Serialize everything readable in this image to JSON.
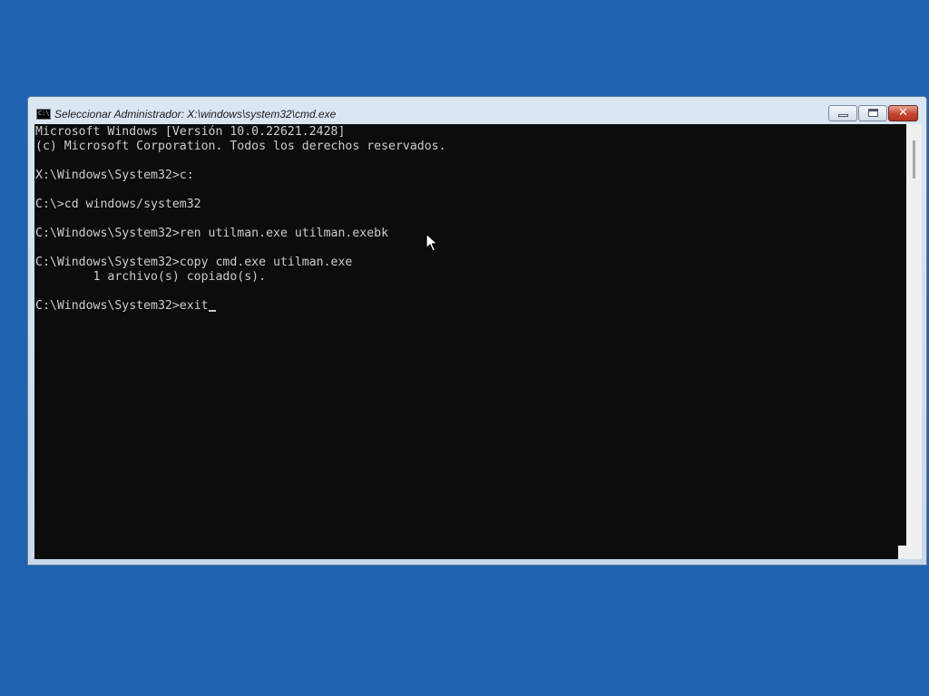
{
  "window": {
    "title": "Seleccionar Administrador: X:\\windows\\system32\\cmd.exe",
    "icon": "cmd-icon",
    "icon_glyph": "C:\\",
    "controls": {
      "minimize": "minimize-icon",
      "maximize": "maximize-icon",
      "close": "close-icon",
      "close_glyph": "✕"
    }
  },
  "console": {
    "lines": [
      "Microsoft Windows [Versión 10.0.22621.2428]",
      "(c) Microsoft Corporation. Todos los derechos reservados.",
      "",
      "X:\\Windows\\System32>c:",
      "",
      "C:\\>cd windows/system32",
      "",
      "C:\\Windows\\System32>ren utilman.exe utilman.exebk",
      "",
      "C:\\Windows\\System32>copy cmd.exe utilman.exe",
      "        1 archivo(s) copiado(s).",
      "",
      "C:\\Windows\\System32>exit"
    ],
    "text_color": "#cccccc",
    "background_color": "#0c0c0c"
  },
  "desktop": {
    "background_color": "#1f63b0"
  }
}
